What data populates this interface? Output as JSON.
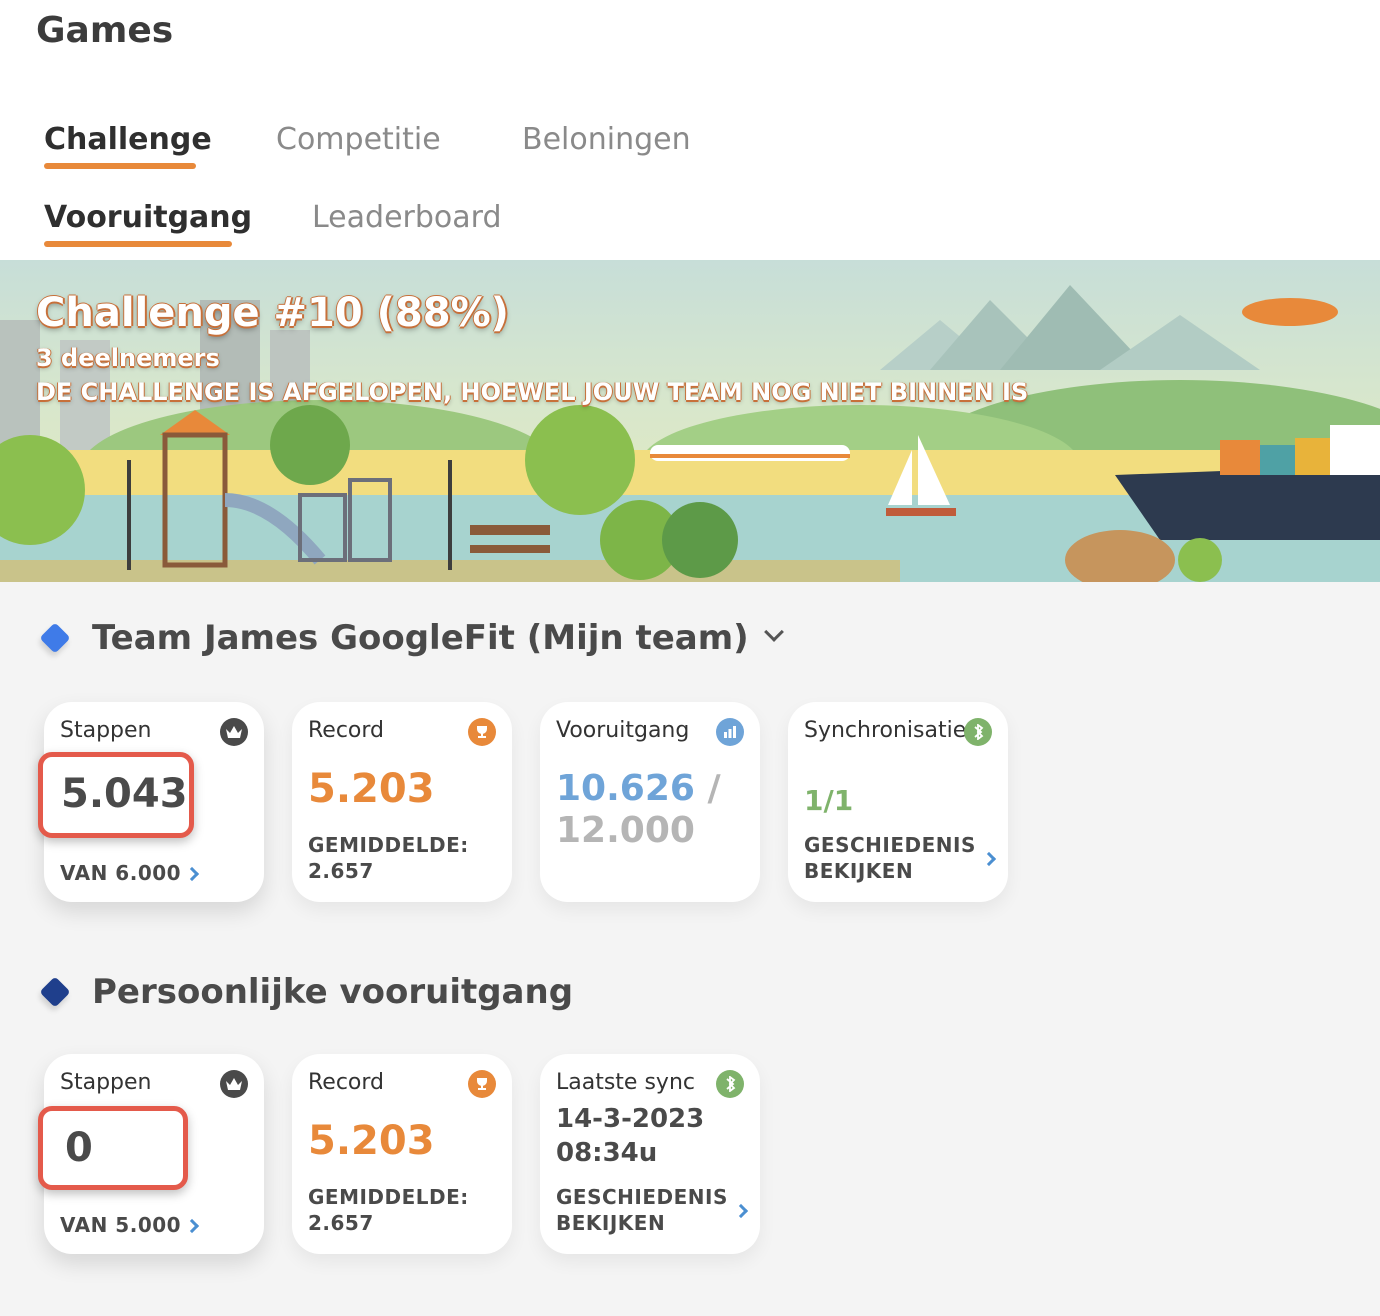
{
  "header": {
    "title": "Games"
  },
  "tabs": [
    {
      "label": "Challenge",
      "active": true
    },
    {
      "label": "Competitie",
      "active": false
    },
    {
      "label": "Beloningen",
      "active": false
    }
  ],
  "subtabs": [
    {
      "label": "Vooruitgang",
      "active": true
    },
    {
      "label": "Leaderboard",
      "active": false
    }
  ],
  "banner": {
    "title": "Challenge #10 (88%)",
    "participants": "3 deelnemers",
    "message": "DE CHALLENGE IS AFGELOPEN, HOEWEL JOUW TEAM NOG NIET BINNEN IS"
  },
  "team": {
    "title": "Team James GoogleFit (Mijn team)",
    "accent": "#3f7be8",
    "cards": {
      "steps": {
        "label": "Stappen",
        "value": "5.043",
        "footer": "VAN 6.000",
        "icon": "crown-icon"
      },
      "record": {
        "label": "Record",
        "value": "5.203",
        "footer_line1": "GEMIDDELDE:",
        "footer_line2": "2.657",
        "icon": "trophy-icon"
      },
      "progress": {
        "label": "Vooruitgang",
        "current": "10.626",
        "separator": "/",
        "target": "12.000",
        "icon": "chart-icon"
      },
      "sync": {
        "label": "Synchronisatie",
        "value": "1/1",
        "footer_line1": "GESCHIEDENIS",
        "footer_line2": "BEKIJKEN",
        "icon": "sync-icon"
      }
    }
  },
  "personal": {
    "title": "Persoonlijke vooruitgang",
    "accent": "#1f3f8c",
    "cards": {
      "steps": {
        "label": "Stappen",
        "value": "0",
        "footer": "VAN 5.000",
        "icon": "crown-icon"
      },
      "record": {
        "label": "Record",
        "value": "5.203",
        "footer_line1": "GEMIDDELDE:",
        "footer_line2": "2.657",
        "icon": "trophy-icon"
      },
      "last_sync": {
        "label": "Laatste sync",
        "date": "14-3-2023",
        "time": "08:34u",
        "footer_line1": "GESCHIEDENIS",
        "footer_line2": "BEKIJKEN",
        "icon": "sync-icon"
      }
    }
  },
  "colors": {
    "orange": "#e8893a",
    "blue": "#6fa4d8",
    "green": "#7fb36b",
    "highlight": "#e45a4b"
  }
}
